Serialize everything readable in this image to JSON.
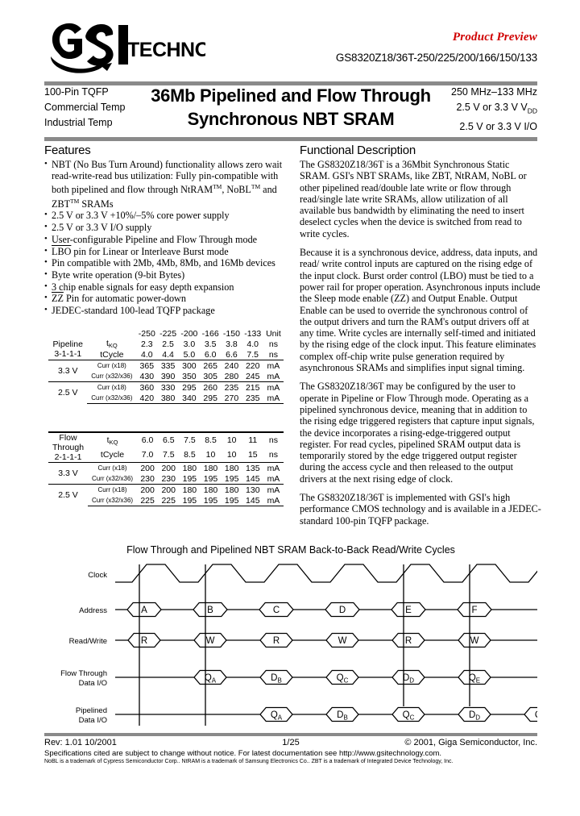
{
  "header": {
    "logo_text": "TECHNOLOGY",
    "logo_mark": "gsi-logo",
    "product_preview": "Product Preview",
    "part_number": "GS8320Z18/36T-250/225/200/166/150/133"
  },
  "title_band": {
    "left_lines": [
      "100-Pin TQFP",
      "Commercial Temp",
      "Industrial Temp"
    ],
    "title_line1": "36Mb Pipelined and Flow Through",
    "title_line2": "Synchronous NBT SRAM",
    "right_lines": [
      "250 MHz–133 MHz",
      "2.5 V or 3.3 V V",
      "2.5 V or 3.3 V I/O"
    ],
    "right_line2_sub": "DD"
  },
  "features": {
    "heading": "Features",
    "items": [
      "NBT (No Bus Turn Around) functionality allows zero wait read-write-read bus utilization: Fully pin-compatible with both pipelined and flow through NtRAM™, NoBL™ and ZBT™ SRAMs",
      "2.5 V or 3.3 V +10%/–5% core power supply",
      "2.5 V or 3.3 V I/O supply",
      "User-configurable Pipeline and Flow Through mode",
      "LBO pin for Linear or Interleave Burst mode",
      "Pin compatible with 2Mb, 4Mb, 8Mb, and 16Mb devices",
      "Byte write operation (9-bit Bytes)",
      "3 chip enable signals for easy depth expansion",
      "ZZ Pin for automatic power-down",
      "JEDEC-standard 100-lead TQFP  package"
    ]
  },
  "functional_description": {
    "heading": "Functional Description",
    "paragraphs": [
      "The GS8320Z18/36T is a 36Mbit Synchronous Static SRAM. GSI's NBT SRAMs, like ZBT, NtRAM, NoBL or other pipelined read/double late write or flow through read/single late write SRAMs, allow utilization of all available bus bandwidth by eliminating the need to insert deselect cycles when the device is switched from read to write cycles.",
      "Because it is a synchronous device, address, data inputs, and read/ write control inputs are captured on the rising edge of the input clock. Burst order control (LBO) must be tied to a power rail for proper operation. Asynchronous inputs include the Sleep mode enable (ZZ) and Output Enable. Output Enable can be used to override the synchronous control of the output drivers and turn the RAM's output drivers off at any time. Write cycles are internally self-timed and initiated by the rising edge of the clock input. This feature eliminates complex off-chip write pulse generation required by asynchronous SRAMs and simplifies input signal timing.",
      "The GS8320Z18/36T  may be configured by the user to operate in Pipeline or Flow Through mode. Operating as a pipelined synchronous device, meaning that in addition to the rising edge triggered registers that capture input signals, the device incorporates a rising-edge-triggered output register. For read cycles, pipelined SRAM output data is temporarily stored by the edge triggered output register during the access cycle and then released to the output drivers at the next rising edge of clock.",
      "The GS8320Z18/36T is implemented with GSI's high performance CMOS technology and is available in a JEDEC-standard 100-pin TQFP package."
    ]
  },
  "spec_tables": {
    "speed_bins": [
      "-250",
      "-225",
      "-200",
      "-166",
      "-150",
      "-133"
    ],
    "unit_header": "Unit",
    "pipeline": {
      "mode_label_line1": "Pipeline",
      "mode_label_line2": "3-1-1-1",
      "rows": [
        {
          "param": "t",
          "param_sub": "KQ",
          "values": [
            "2.3",
            "2.5",
            "3.0",
            "3.5",
            "3.8",
            "4.0"
          ],
          "unit": "ns"
        },
        {
          "param": "tCycle",
          "param_sub": "",
          "values": [
            "4.0",
            "4.4",
            "5.0",
            "6.0",
            "6.6",
            "7.5"
          ],
          "unit": "ns"
        }
      ],
      "v33_label": "3.3 V",
      "v33_rows": [
        {
          "param": "Curr (x18)",
          "values": [
            "365",
            "335",
            "300",
            "265",
            "240",
            "220"
          ],
          "unit": "mA"
        },
        {
          "param": "Curr (x32/x36)",
          "values": [
            "430",
            "390",
            "350",
            "305",
            "280",
            "245"
          ],
          "unit": "mA"
        }
      ],
      "v25_label": "2.5 V",
      "v25_rows": [
        {
          "param": "Curr (x18)",
          "values": [
            "360",
            "330",
            "295",
            "260",
            "235",
            "215"
          ],
          "unit": "mA"
        },
        {
          "param": "Curr (x32/x36)",
          "values": [
            "420",
            "380",
            "340",
            "295",
            "270",
            "235"
          ],
          "unit": "mA"
        }
      ]
    },
    "flow_through": {
      "mode_label_line1": "Flow",
      "mode_label_line2": "Through",
      "mode_label_line3": "2-1-1-1",
      "rows": [
        {
          "param": "t",
          "param_sub": "KQ",
          "values": [
            "6.0",
            "6.5",
            "7.5",
            "8.5",
            "10",
            "11"
          ],
          "unit": "ns"
        },
        {
          "param": "tCycle",
          "param_sub": "",
          "values": [
            "7.0",
            "7.5",
            "8.5",
            "10",
            "10",
            "15"
          ],
          "unit": "ns"
        }
      ],
      "v33_label": "3.3 V",
      "v33_rows": [
        {
          "param": "Curr (x18)",
          "values": [
            "200",
            "200",
            "180",
            "180",
            "180",
            "135"
          ],
          "unit": "mA"
        },
        {
          "param": "Curr (x32/x36)",
          "values": [
            "230",
            "230",
            "195",
            "195",
            "195",
            "145"
          ],
          "unit": "mA"
        }
      ],
      "v25_label": "2.5 V",
      "v25_rows": [
        {
          "param": "Curr (x18)",
          "values": [
            "200",
            "200",
            "180",
            "180",
            "180",
            "130"
          ],
          "unit": "mA"
        },
        {
          "param": "Curr (x32/x36)",
          "values": [
            "225",
            "225",
            "195",
            "195",
            "195",
            "145"
          ],
          "unit": "mA"
        }
      ]
    }
  },
  "timing_diagram": {
    "title": "Flow Through and Pipelined NBT SRAM Back-to-Back Read/Write Cycles",
    "row_labels": [
      "Clock",
      "Address",
      "Read/Write",
      "Flow Through\nData I/O",
      "Pipelined\nData I/O"
    ],
    "clock_label": "Clock",
    "address_label": "Address",
    "readwrite_label": "Read/Write",
    "flowthrough_label_l1": "Flow Through",
    "flowthrough_label_l2": "Data I/O",
    "pipelined_label_l1": "Pipelined",
    "pipelined_label_l2": "Data I/O",
    "address_cells": [
      "A",
      "B",
      "C",
      "D",
      "E",
      "F"
    ],
    "readwrite_cells": [
      "R",
      "W",
      "R",
      "W",
      "R",
      "W"
    ],
    "flowthrough_cells": [
      {
        "main": "Q",
        "sub": "A"
      },
      {
        "main": "D",
        "sub": "B"
      },
      {
        "main": "Q",
        "sub": "C"
      },
      {
        "main": "D",
        "sub": "D"
      },
      {
        "main": "Q",
        "sub": "E"
      }
    ],
    "pipelined_cells": [
      {
        "main": "Q",
        "sub": "A"
      },
      {
        "main": "D",
        "sub": "B"
      },
      {
        "main": "Q",
        "sub": "C"
      },
      {
        "main": "D",
        "sub": "D"
      },
      {
        "main": "Q",
        "sub": "E"
      }
    ]
  },
  "footer": {
    "revision": "Rev: 1.01  10/2001",
    "page": "1/25",
    "copyright": "© 2001, Giga Semiconductor, Inc.",
    "disclaimer": "Specifications cited are subject to change without notice. For latest documentation see http://www.gsitechnology.com.",
    "trademarks": "NoBL is a trademark of Cypress Semiconductor Corp.. NtRAM is a trademark of Samsung Electronics Co.. ZBT is a trademark of Integrated Device Technology, Inc."
  },
  "colors": {
    "rule": "#8a8a8a",
    "product_preview": "#d00000",
    "text": "#000000"
  }
}
